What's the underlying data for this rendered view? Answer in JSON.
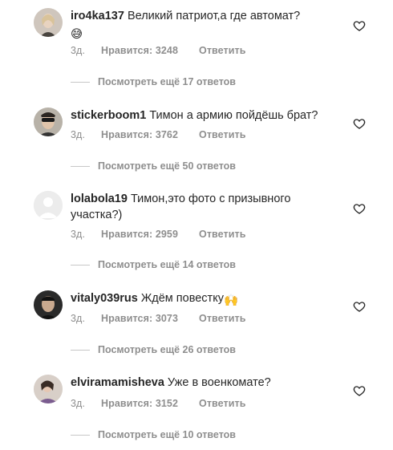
{
  "comments": [
    {
      "username": "iro4ka137",
      "text": "Великий патриот,а где автомат?",
      "emoji": "😅",
      "date": "3д.",
      "likes": "Нравится: 3248",
      "reply": "Ответить",
      "view_replies": "Посмотреть ещё 17 ответов"
    },
    {
      "username": "stickerboom1",
      "text": "Тимон а армию пойдёшь брат?",
      "emoji": "",
      "date": "3д.",
      "likes": "Нравится: 3762",
      "reply": "Ответить",
      "view_replies": "Посмотреть ещё 50 ответов"
    },
    {
      "username": "lolabola19",
      "text": "Тимон,это фото с призывного участка?)",
      "emoji": "",
      "date": "3д.",
      "likes": "Нравится: 2959",
      "reply": "Ответить",
      "view_replies": "Посмотреть ещё 14 ответов"
    },
    {
      "username": "vitaly039rus",
      "text": "Ждём повестку",
      "emoji": "🙌",
      "date": "3д.",
      "likes": "Нравится: 3073",
      "reply": "Ответить",
      "view_replies": "Посмотреть ещё 26 ответов"
    },
    {
      "username": "elviramamisheva",
      "text": "Уже в военкомате?",
      "emoji": "",
      "date": "3д.",
      "likes": "Нравится: 3152",
      "reply": "Ответить",
      "view_replies": "Посмотреть ещё 10 ответов"
    }
  ],
  "colors": {
    "text": "#262626",
    "secondary": "#8e8e8e",
    "line": "#c7c7c7"
  }
}
